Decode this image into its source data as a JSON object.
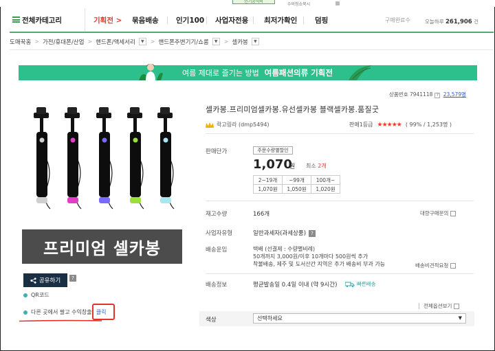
{
  "top": {
    "tab_fragment": "인기공식비",
    "right_fragment": "수비청쇼북시"
  },
  "nav": {
    "category_label": "전체카테고리",
    "items": [
      {
        "label": "기획전 >",
        "highlight": true
      },
      {
        "label": "묶음배송"
      },
      {
        "label": "인기100"
      },
      {
        "label": "사업자전용"
      },
      {
        "label": "최저가확인"
      },
      {
        "label": "덤핑"
      }
    ],
    "right_label": "구매완료수",
    "right_value_prefix": "오늘하루",
    "right_value": "261,906",
    "right_value_suffix": "건"
  },
  "breadcrumb": [
    "도매꾹홈",
    "가전/휴대폰/산업",
    "핸드폰/액세서리",
    "핸드폰주변기기/쇼룸",
    "셀카봉"
  ],
  "banner": {
    "text_light": "여름 제대로 즐기는 방법",
    "text_bold": "여름패션의류 기획전"
  },
  "product": {
    "code_label": "상품번호 7941118",
    "views": "23,579명",
    "title": "셀카봉.프리미엄셀카봉.유선셀카봉 블랙셀카봉.품질굿",
    "seller": "락고링라 (dmp5494)",
    "grade_label": "판매1등급",
    "rating_stars": 4.5,
    "rating_text": "( 99% / 1,253명 )",
    "image_caption": "프리미엄 셀카봉",
    "pole_colors": [
      "#cfcfcf",
      "#e040c8",
      "#7a6bff",
      "#9be03a",
      "#a9e6f0"
    ]
  },
  "price": {
    "label": "판매단가",
    "discount_badge": "주문수량별할인",
    "amount": "1,070",
    "unit": "원",
    "min_qty_label": "최소",
    "min_qty": "2개",
    "tiers": [
      {
        "range": "2~19개",
        "price": "1,070원"
      },
      {
        "range": "~99개",
        "price": "1,050원"
      },
      {
        "range": "100개~",
        "price": "1,020원"
      }
    ]
  },
  "stock": {
    "label": "재고수량",
    "value": "166개",
    "bulk_label": "대량구매문의"
  },
  "biz": {
    "label": "사업자유형",
    "value": "일반과세자(과세상품)"
  },
  "shipping": {
    "label": "배송운임",
    "lines": [
      "택배 (선결제 : 수량별비례)",
      "50개까지 3,000원/이후 10개마다 500원씩 추가",
      "착불배송, 제주 및 도서산간 지역은 추가 배송비 부과 가능"
    ],
    "calc_label": "배송비견적요청"
  },
  "ship_info": {
    "label": "배송정보",
    "value": "평균발송일 0.4일 이내 (약 9시간)",
    "fast_label": "빠른배송"
  },
  "share": {
    "button": "공유하기",
    "qr": "QR코드",
    "earn_text": "다른 곳에서 팔고 수익창출!",
    "earn_link": "클릭"
  },
  "options": {
    "view_all": "전체옵션보기",
    "color_label": "색상",
    "select_placeholder": "선택하세요"
  },
  "colors": {
    "accent_green": "#59a869",
    "banner": "#2dbf8c",
    "highlight_red": "#e2322a",
    "star": "#e7412f"
  }
}
